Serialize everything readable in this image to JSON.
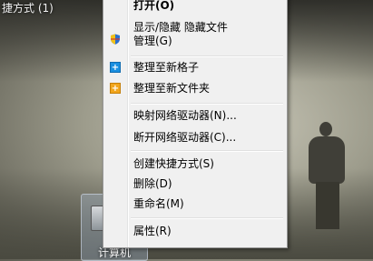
{
  "desktop": {
    "shortcut_label": "捷方式 (1)",
    "icon_caption": "计算机"
  },
  "menu": {
    "items": [
      {
        "label": "打开(O)",
        "bold": true
      },
      {
        "label": "显示/隐藏 隐藏文件"
      },
      {
        "label": "管理(G)",
        "icon": "uac-shield-icon"
      },
      {
        "label": "整理至新格子",
        "icon": "add-blue-icon"
      },
      {
        "label": "整理至新文件夹",
        "icon": "add-orange-icon"
      },
      {
        "label": "映射网络驱动器(N)..."
      },
      {
        "label": "断开网络驱动器(C)..."
      },
      {
        "label": "创建快捷方式(S)"
      },
      {
        "label": "删除(D)"
      },
      {
        "label": "重命名(M)"
      },
      {
        "label": "属性(R)"
      }
    ]
  },
  "colors": {
    "menu_bg": "#f0f0f0",
    "blue_icon": "#1a8fe0",
    "orange_icon": "#f2a61d"
  }
}
